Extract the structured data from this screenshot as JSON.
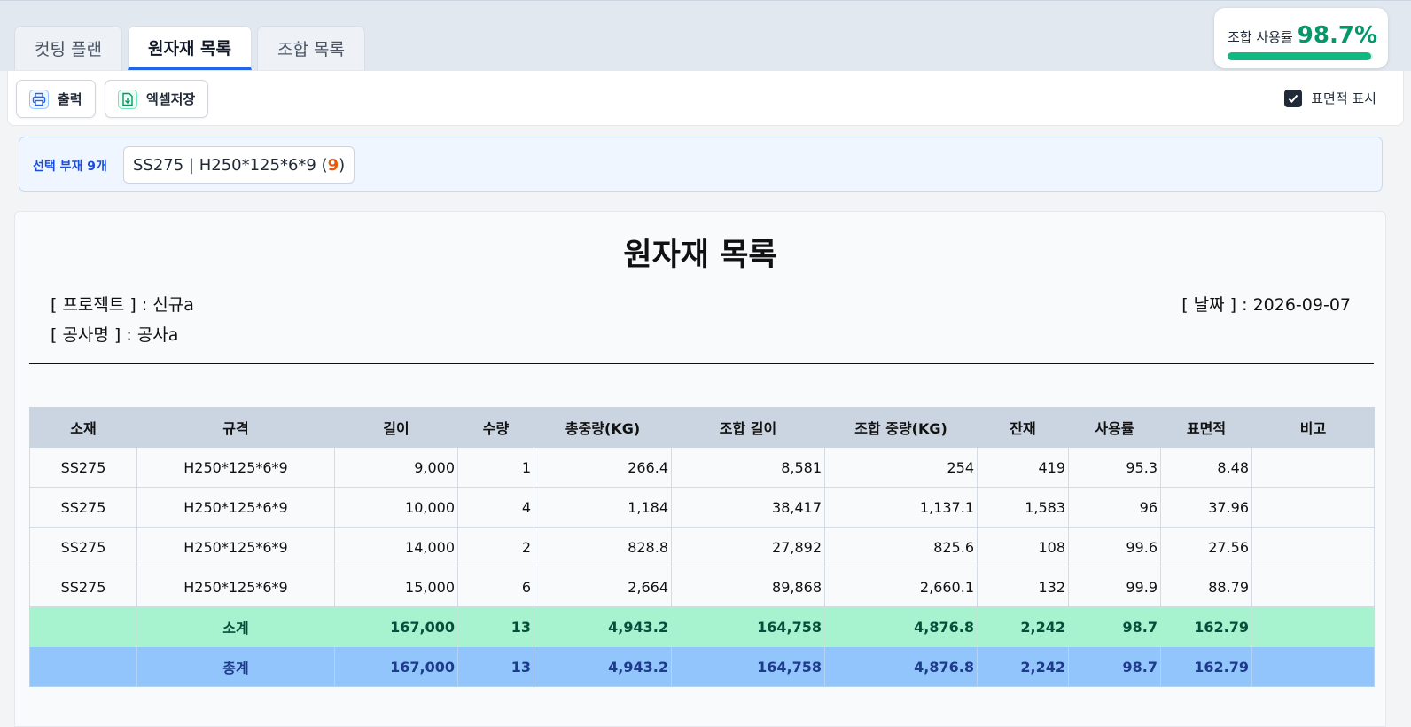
{
  "tabs": [
    {
      "label": "컷팅 플랜",
      "active": false
    },
    {
      "label": "원자재 목록",
      "active": true
    },
    {
      "label": "조합 목록",
      "active": false
    }
  ],
  "usage": {
    "label": "조합 사용률",
    "value": "98.7%",
    "percent": 98.7
  },
  "toolbar": {
    "print_label": "출력",
    "excel_label": "엑셀저장",
    "area_toggle_label": "표면적 표시",
    "area_toggle_checked": true
  },
  "selection": {
    "label": "선택 부재 9개",
    "chip_text": "SS275 | H250*125*6*9 (",
    "chip_count": "9",
    "chip_close": ")"
  },
  "report": {
    "title": "원자재 목록",
    "project": "[ 프로젝트 ] : 신규a",
    "site": "[ 공사명 ] : 공사a",
    "date": "[ 날짜 ] : 2026-09-07",
    "columns": [
      "소재",
      "규격",
      "길이",
      "수량",
      "총중량(KG)",
      "조합 길이",
      "조합 중량(KG)",
      "잔재",
      "사용률",
      "표면적",
      "비고"
    ],
    "rows": [
      [
        "SS275",
        "H250*125*6*9",
        "9,000",
        "1",
        "266.4",
        "8,581",
        "254",
        "419",
        "95.3",
        "8.48",
        ""
      ],
      [
        "SS275",
        "H250*125*6*9",
        "10,000",
        "4",
        "1,184",
        "38,417",
        "1,137.1",
        "1,583",
        "96",
        "37.96",
        ""
      ],
      [
        "SS275",
        "H250*125*6*9",
        "14,000",
        "2",
        "828.8",
        "27,892",
        "825.6",
        "108",
        "99.6",
        "27.56",
        ""
      ],
      [
        "SS275",
        "H250*125*6*9",
        "15,000",
        "6",
        "2,664",
        "89,868",
        "2,660.1",
        "132",
        "99.9",
        "88.79",
        ""
      ]
    ],
    "subtotal": [
      "",
      "소계",
      "167,000",
      "13",
      "4,943.2",
      "164,758",
      "4,876.8",
      "2,242",
      "98.7",
      "162.79",
      ""
    ],
    "total": [
      "",
      "총계",
      "167,000",
      "13",
      "4,943.2",
      "164,758",
      "4,876.8",
      "2,242",
      "98.7",
      "162.79",
      ""
    ]
  },
  "colors": {
    "accent": "#2563eb",
    "usage": "#10b981",
    "subtotal_bg": "#a7f3d0",
    "total_bg": "#93c5fd"
  }
}
